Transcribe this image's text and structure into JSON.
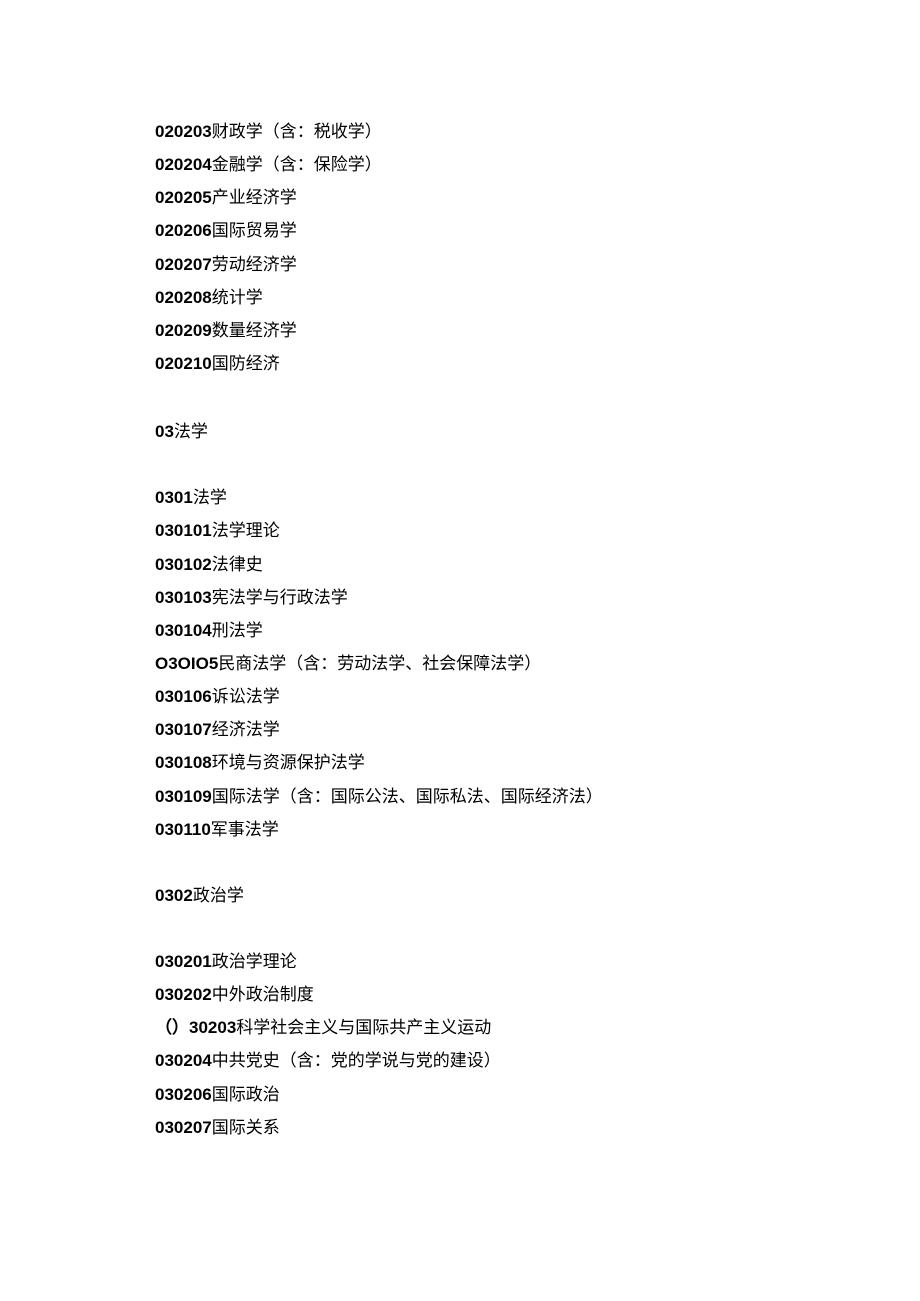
{
  "block1": [
    {
      "code": "020203",
      "label": "财政学（含：税收学）"
    },
    {
      "code": "020204",
      "label": "金融学（含：保险学）"
    },
    {
      "code": "020205",
      "label": "产业经济学"
    },
    {
      "code": "020206",
      "label": "国际贸易学"
    },
    {
      "code": "020207",
      "label": "劳动经济学"
    },
    {
      "code": "020208",
      "label": "统计学"
    },
    {
      "code": "020209",
      "label": "数量经济学"
    },
    {
      "code": "020210",
      "label": "国防经济"
    }
  ],
  "header03": {
    "code": "03",
    "label": "法学"
  },
  "block2_header": {
    "code": "0301",
    "label": "法学"
  },
  "block2": [
    {
      "code": "030101",
      "label": "法学理论"
    },
    {
      "code": "030102",
      "label": "法律史"
    },
    {
      "code": "030103",
      "label": "宪法学与行政法学"
    },
    {
      "code": "030104",
      "label": "刑法学"
    },
    {
      "code": "O3OIO5",
      "label": "民商法学（含：劳动法学、社会保障法学）"
    },
    {
      "code": "030106",
      "label": "诉讼法学"
    },
    {
      "code": "030107",
      "label": "经济法学"
    },
    {
      "code": "030108",
      "label": "环境与资源保护法学"
    },
    {
      "code": "030109",
      "label": "国际法学（含：国际公法、国际私法、国际经济法）"
    },
    {
      "code": "030110",
      "label": "军事法学"
    }
  ],
  "block3_header": {
    "code": "0302",
    "label": "政治学"
  },
  "block3": [
    {
      "code": "030201",
      "label": "政治学理论"
    },
    {
      "code": "030202",
      "label": "中外政治制度"
    },
    {
      "code": "（）30203",
      "label": "科学社会主义与国际共产主义运动"
    },
    {
      "code": "030204",
      "label": "中共党史（含：党的学说与党的建设）"
    },
    {
      "code": "030206",
      "label": "国际政治"
    },
    {
      "code": "030207",
      "label": "国际关系"
    }
  ]
}
